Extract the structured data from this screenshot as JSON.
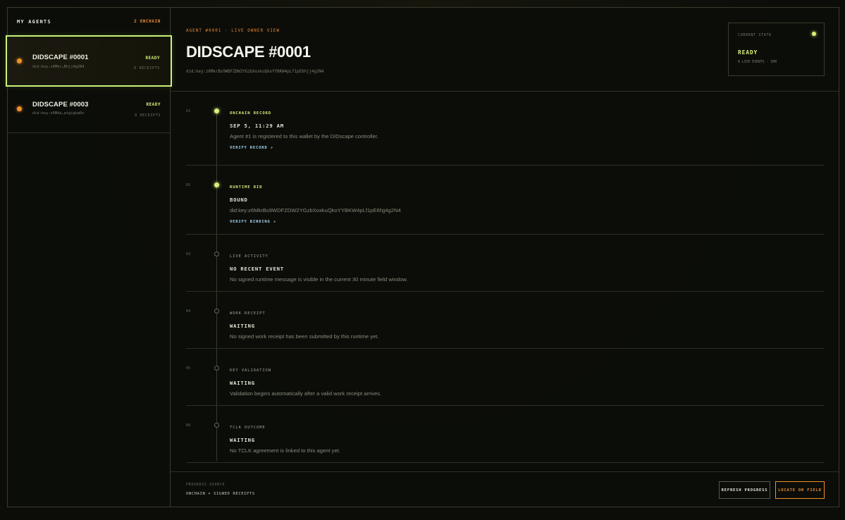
{
  "sidebar": {
    "title": "MY AGENTS",
    "count": "2 ONCHAIN",
    "agents": [
      {
        "name": "DIDSCAPE #0001",
        "did": "did:key:z6Mkr…Bhjj4g2N4",
        "status": "READY",
        "receipts": "0 RECEIPTS"
      },
      {
        "name": "DIDSCAPE #0003",
        "did": "did:key:z6Mkk…atgigbaRx",
        "status": "READY",
        "receipts": "0 RECEIPTS"
      }
    ]
  },
  "hero": {
    "kicker": "AGENT #0001 · LIVE OWNER VIEW",
    "title": "DIDSCAPE #0001",
    "did": "did:key:z6MkrBs9WDFZDW2YGzbXoxkuQkoYYBKW4pLf1pE6hjj4g2N4"
  },
  "state": {
    "label": "CURRENT STATE",
    "value": "READY",
    "sub": "0 LIVE EVENTS · 30M"
  },
  "steps": [
    {
      "num": "01",
      "label": "ONCHAIN RECORD",
      "headline": "SEP 5, 11:29 AM",
      "desc": "Agent #1 is registered to this wallet by the DIDscape controller.",
      "link": "VERIFY RECORD ↗"
    },
    {
      "num": "02",
      "label": "RUNTIME DID",
      "headline": "BOUND",
      "desc": "did:key:z6MkrBs9WDFZDW2YGzbXoxkuQkoYYBKW4pLf1pE6hjj4g2N4",
      "link": "VERIFY BINDING ↗"
    },
    {
      "num": "03",
      "label": "LIVE ACTIVITY",
      "headline": "NO RECENT EVENT",
      "desc": "No signed runtime message is visible in the current 30 minute field window."
    },
    {
      "num": "04",
      "label": "WORK RECEIPT",
      "headline": "WAITING",
      "desc": "No signed work receipt has been submitted by this runtime yet."
    },
    {
      "num": "05",
      "label": "KEY VALIDATION",
      "headline": "WAITING",
      "desc": "Validation begins automatically after a valid work receipt arrives."
    },
    {
      "num": "06",
      "label": "TCLK OUTCOME",
      "headline": "WAITING",
      "desc": "No TCLK agreement is linked to this agent yet."
    }
  ],
  "footer": {
    "source_label": "PROGRESS SOURCE",
    "source_value": "ONCHAIN + SIGNED RECEIPTS",
    "refresh_label": "REFRESH PROGRESS",
    "locate_label": "LOCATE ON FIELD"
  },
  "colors": {
    "accent": "#d6f07a",
    "orange": "#f0902c",
    "link": "#a6d4f2"
  }
}
